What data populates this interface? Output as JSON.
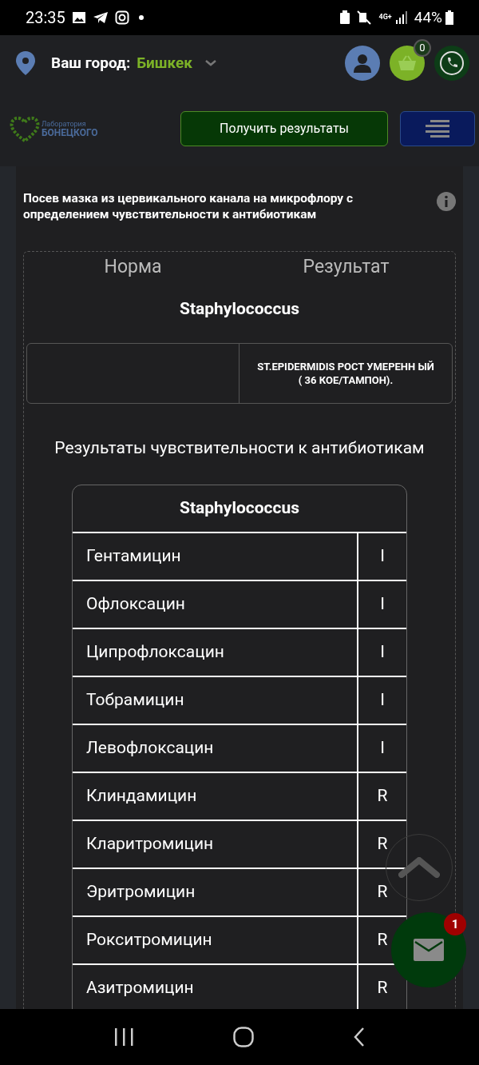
{
  "status_bar": {
    "time": "23:35",
    "battery": "44%",
    "network": "4G+"
  },
  "header": {
    "city_label": "Ваш город:",
    "city": "Бишкек",
    "cart_count": "0"
  },
  "nav": {
    "logo_line1": "Лаборатория",
    "logo_line2": "БОНЕЦКОГО",
    "results_button": "Получить результаты"
  },
  "test": {
    "title": "Посев мазка из цервикального канала на микрофлору с определением чувствительности к антибиотикам",
    "columns": [
      "Норма",
      "Результат"
    ],
    "organism": "Staphylococcus",
    "result": "ST.EPIDERMIDIS РОСТ УМЕРЕНН ЫЙ ( 36 КОЕ/ТАМПОН).",
    "sensitivity_title": "Результаты чувствительности к антибиотикам",
    "sensitivity_table": {
      "header": "Staphylococcus",
      "rows": [
        {
          "antibiotic": "Гентамицин",
          "value": "I"
        },
        {
          "antibiotic": "Офлоксацин",
          "value": "I"
        },
        {
          "antibiotic": "Ципрофлоксацин",
          "value": "I"
        },
        {
          "antibiotic": "Тобрамицин",
          "value": "I"
        },
        {
          "antibiotic": "Левофлоксацин",
          "value": "I"
        },
        {
          "antibiotic": "Клиндамицин",
          "value": "R"
        },
        {
          "antibiotic": "Кларитромицин",
          "value": "R"
        },
        {
          "antibiotic": "Эритромицин",
          "value": "R"
        },
        {
          "antibiotic": "Рокситромицин",
          "value": "R"
        },
        {
          "antibiotic": "Азитромицин",
          "value": "R"
        }
      ]
    }
  },
  "chat_button": {
    "badge": "1"
  }
}
